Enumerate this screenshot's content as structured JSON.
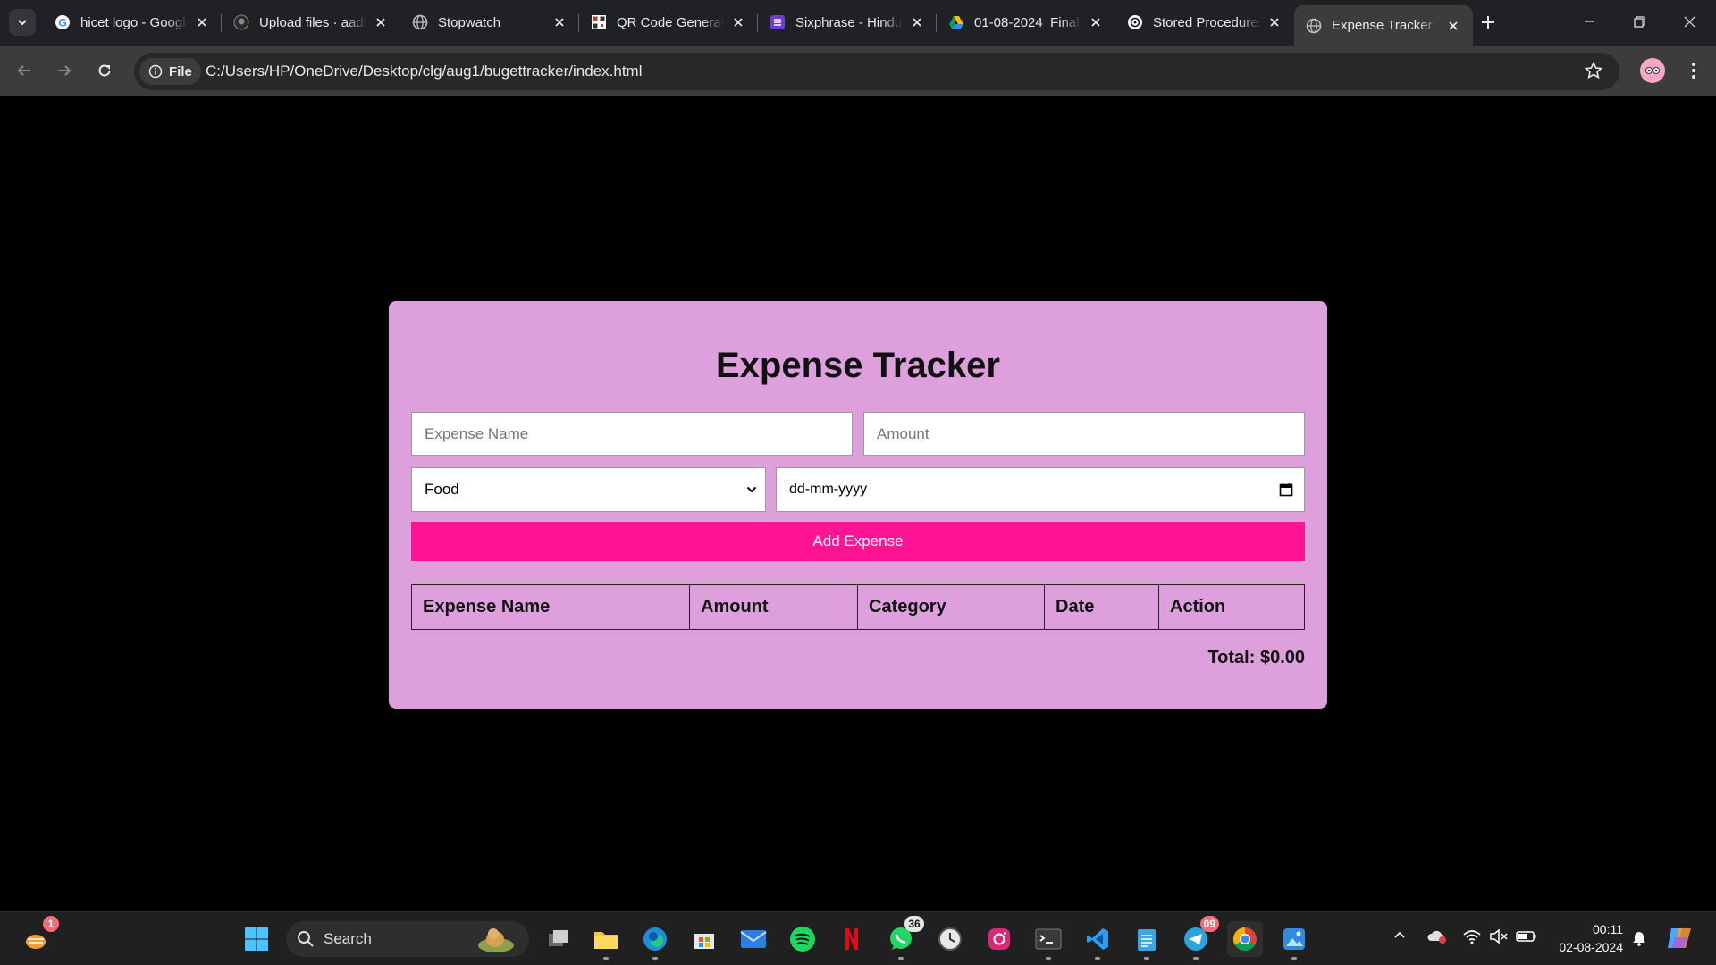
{
  "browser": {
    "tabs": [
      {
        "title": "hicet logo - Google Search",
        "icon": "google-icon"
      },
      {
        "title": "Upload files · aadhithya",
        "icon": "github-icon"
      },
      {
        "title": "Stopwatch",
        "icon": "globe-icon"
      },
      {
        "title": "QR Code Generator",
        "icon": "qr-icon"
      },
      {
        "title": "Sixphrase - Hindusthan",
        "icon": "sixphrase-icon"
      },
      {
        "title": "01-08-2024_Final",
        "icon": "drive-icon"
      },
      {
        "title": "Stored Procedures",
        "icon": "chatgpt-icon"
      },
      {
        "title": "Expense Tracker",
        "icon": "globe-icon"
      }
    ],
    "active_tab_index": 7,
    "security_chip": "File",
    "url": "C:/Users/HP/OneDrive/Desktop/clg/aug1/bugettracker/index.html"
  },
  "app": {
    "title": "Expense Tracker",
    "expense_name_placeholder": "Expense Name",
    "amount_placeholder": "Amount",
    "category_selected": "Food",
    "date_placeholder": "dd-mm-yyyy",
    "add_button": "Add Expense",
    "table_headers": [
      "Expense Name",
      "Amount",
      "Category",
      "Date",
      "Action"
    ],
    "total_label": "Total: $0.00",
    "colors": {
      "card": "#dda0dd",
      "button": "#ff1493"
    }
  },
  "taskbar": {
    "search_label": "Search",
    "widgets_badge": "1",
    "whatsapp_badge": "36",
    "telegram_badge": "09",
    "time": "00:11",
    "date": "02-08-2024"
  }
}
